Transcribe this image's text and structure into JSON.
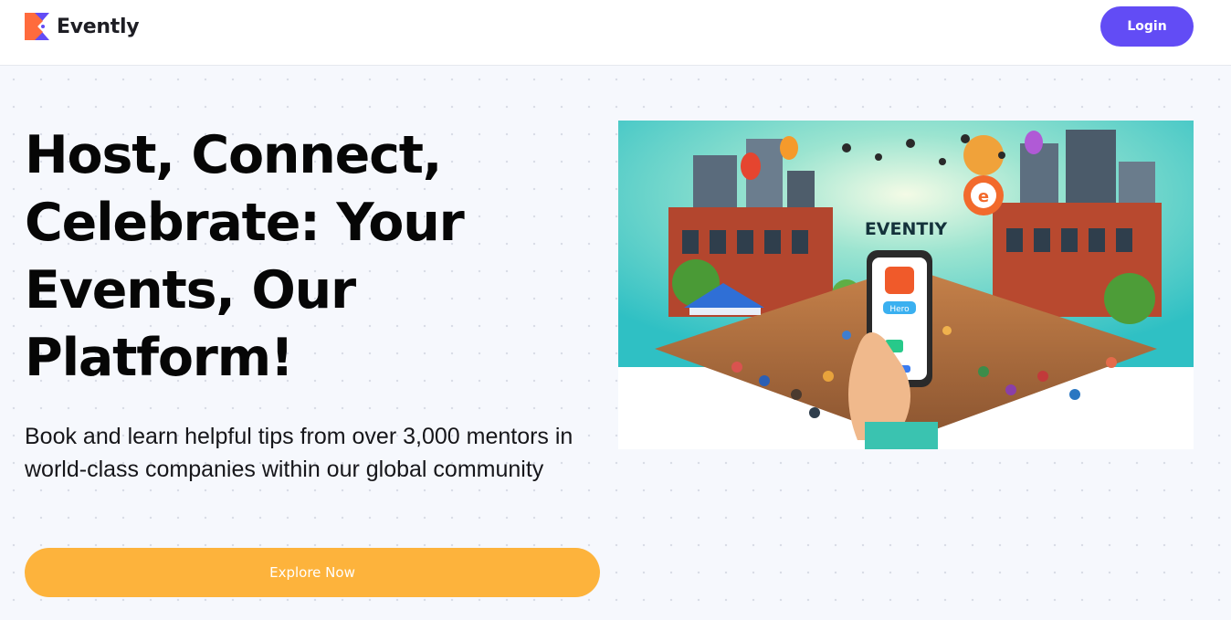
{
  "app": {
    "name": "Evently"
  },
  "header": {
    "logo_text": "Evently",
    "login_label": "Login"
  },
  "hero": {
    "title": "Host, Connect, Celebrate: Your Events, Our Platform!",
    "subtitle": "Book and learn helpful tips from over 3,000 mentors in world-class companies within our global community",
    "cta_label": "Explore Now",
    "image": {
      "sign_text": "EVENTIY",
      "phone_button_text": "Hero",
      "pin_letter": "e"
    }
  },
  "colors": {
    "brand_primary": "#624cf5",
    "cta": "#fdb33c",
    "logo_orange": "#ff6b3d",
    "logo_purple": "#624cf5",
    "background": "#f6f8fd"
  },
  "icons": [
    "evently-logo-icon"
  ]
}
